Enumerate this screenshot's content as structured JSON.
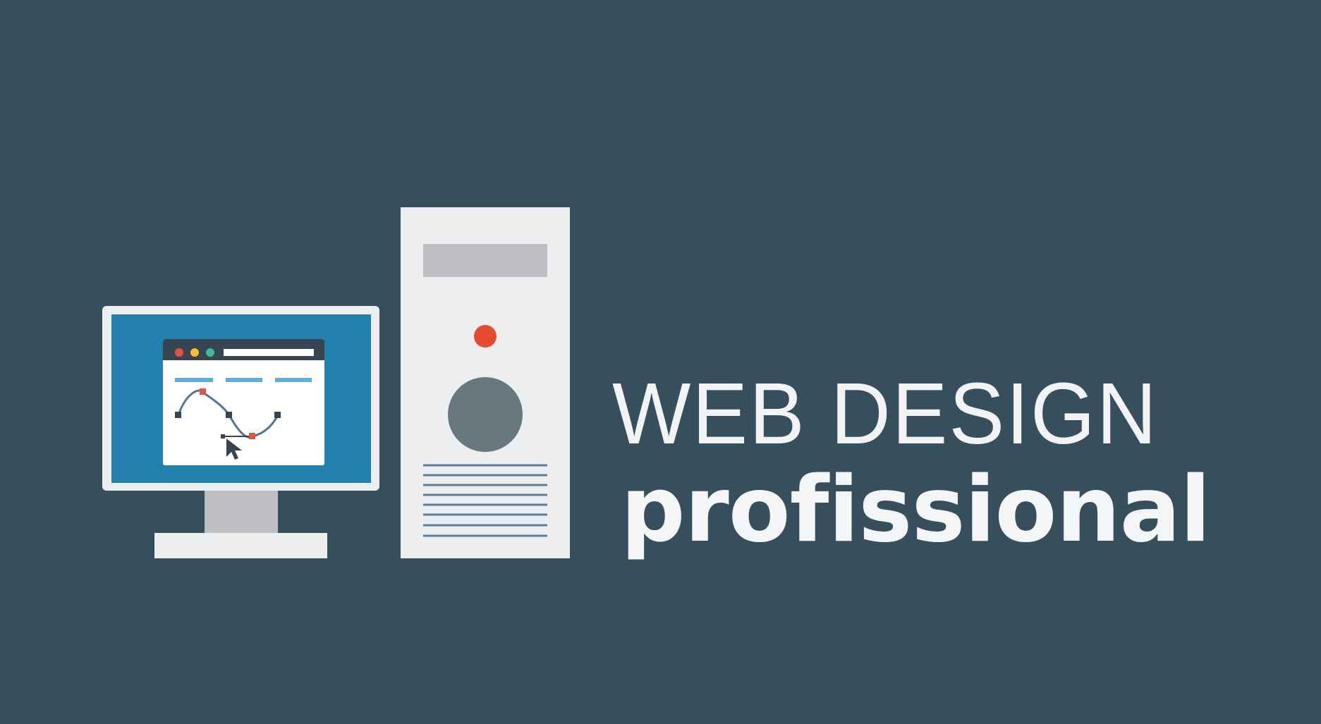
{
  "colors": {
    "background": "#374e5d",
    "device_light": "#eceef0",
    "screen_blue": "#2281ae",
    "tower_slot": "#bdbfc2",
    "power_button": "#e44c2f",
    "speaker_grey": "#67787f",
    "vent_lines": "#5e7f98",
    "dot_red": "#e4533e",
    "dot_yellow": "#f2c12e",
    "dot_green": "#3fba98",
    "menu_bar": "#5daede",
    "curve": "#4f7890",
    "anchor": "#374451",
    "text": "#ffffff"
  },
  "icons": {
    "monitor": "desktop-monitor-icon",
    "tower": "computer-tower-icon",
    "cursor": "mouse-cursor-icon",
    "bezier": "bezier-curve-icon"
  },
  "text": {
    "line1": "WEB DESIGN",
    "line2": "profissional"
  }
}
